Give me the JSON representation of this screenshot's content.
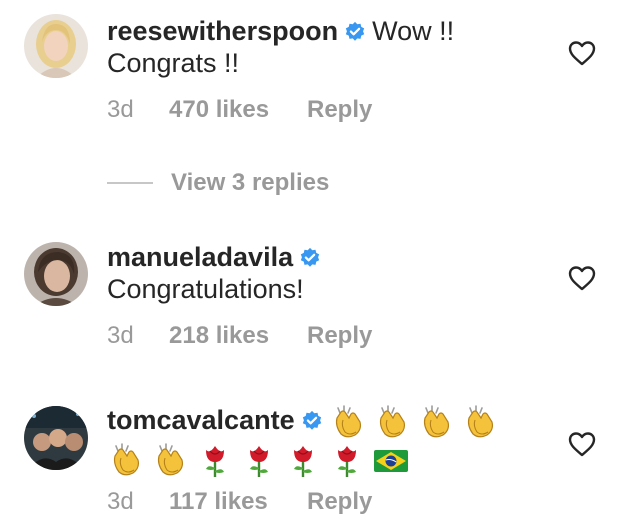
{
  "comments": [
    {
      "username": "reesewitherspoon",
      "text_line1": "Wow !!",
      "text_line2": "Congrats !!",
      "time": "3d",
      "likes": "470 likes",
      "reply": "Reply",
      "verified": true,
      "view_replies": "View 3 replies"
    },
    {
      "username": "manueladavila",
      "text_line1": "",
      "text_line2": "Congratulations!",
      "time": "3d",
      "likes": "218 likes",
      "reply": "Reply",
      "verified": true
    },
    {
      "username": "tomcavalcante",
      "emojis_line1": [
        "clapping-hands",
        "clapping-hands",
        "clapping-hands",
        "clapping-hands"
      ],
      "emojis_line2": [
        "clapping-hands",
        "clapping-hands",
        "rose",
        "rose",
        "rose",
        "rose",
        "brazil-flag"
      ],
      "time": "3d",
      "likes": "117 likes",
      "reply": "Reply",
      "verified": true
    }
  ],
  "colors": {
    "text": "#262626",
    "meta": "#999999",
    "verified_blue": "#3897f0",
    "divider": "#c7c7c7"
  }
}
